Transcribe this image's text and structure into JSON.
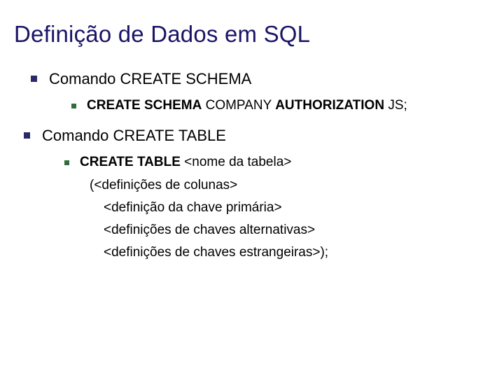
{
  "title": "Definição de Dados em SQL",
  "items": [
    {
      "label_prefix": "Comando ",
      "label_code": "CREATE SCHEMA",
      "sub": [
        {
          "bold": "CREATE SCHEMA",
          "rest": " COMPANY ",
          "bold2": "AUTHORIZATION",
          "rest2": " JS;"
        }
      ]
    },
    {
      "label_prefix": "Comando ",
      "label_code": "CREATE TABLE",
      "sub": [
        {
          "bold": "CREATE TABLE",
          "rest": " <nome da tabela>",
          "lines": [
            "(<definições de colunas>",
            "<definição da chave primária>",
            "<definições de chaves alternativas>",
            "<definições de chaves estrangeiras>);"
          ]
        }
      ]
    }
  ]
}
